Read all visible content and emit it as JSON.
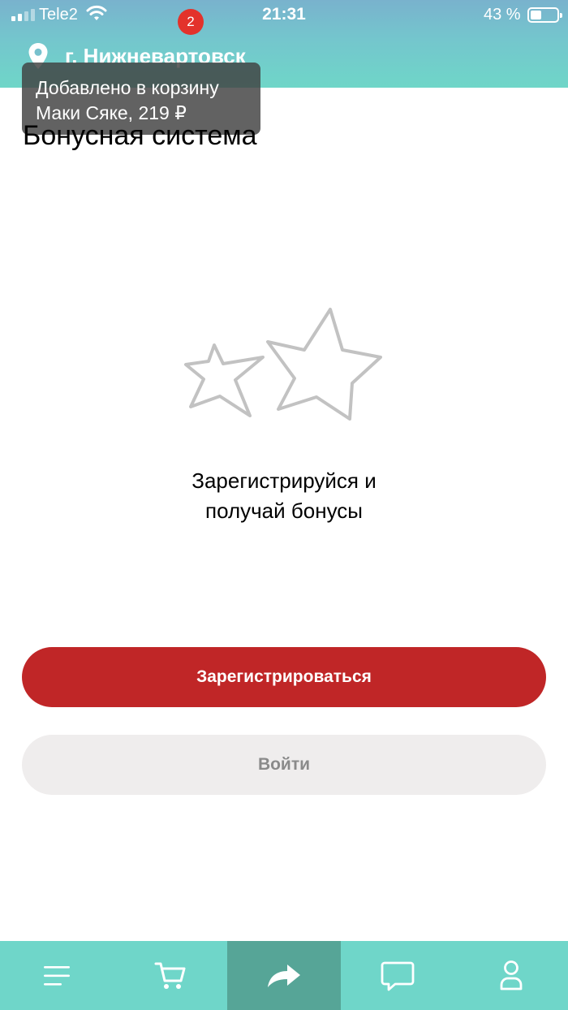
{
  "status_bar": {
    "carrier": "Tele2",
    "time": "21:31",
    "battery": "43 %",
    "battery_level": 0.43
  },
  "header": {
    "location": "г. Нижневартовск",
    "icon": "location-pin-icon"
  },
  "toast": {
    "line1": "Добавлено в корзину",
    "line2": "Маки Сяке, 219 ₽"
  },
  "page": {
    "title": "Бонусная система",
    "illustration": "stars-icon",
    "promo_line1": "Зарегистрируйся и",
    "promo_line2": "получай бонусы"
  },
  "buttons": {
    "register": "Зарегистрироваться",
    "login": "Войти"
  },
  "tabbar": {
    "cart_count": "2",
    "items": [
      "menu-icon",
      "cart-icon",
      "share-icon",
      "chat-icon",
      "profile-icon"
    ]
  },
  "colors": {
    "accent_red": "#c02627",
    "teal": "#6fd6c9",
    "teal_active": "#56a597",
    "badge": "#e3322b"
  }
}
